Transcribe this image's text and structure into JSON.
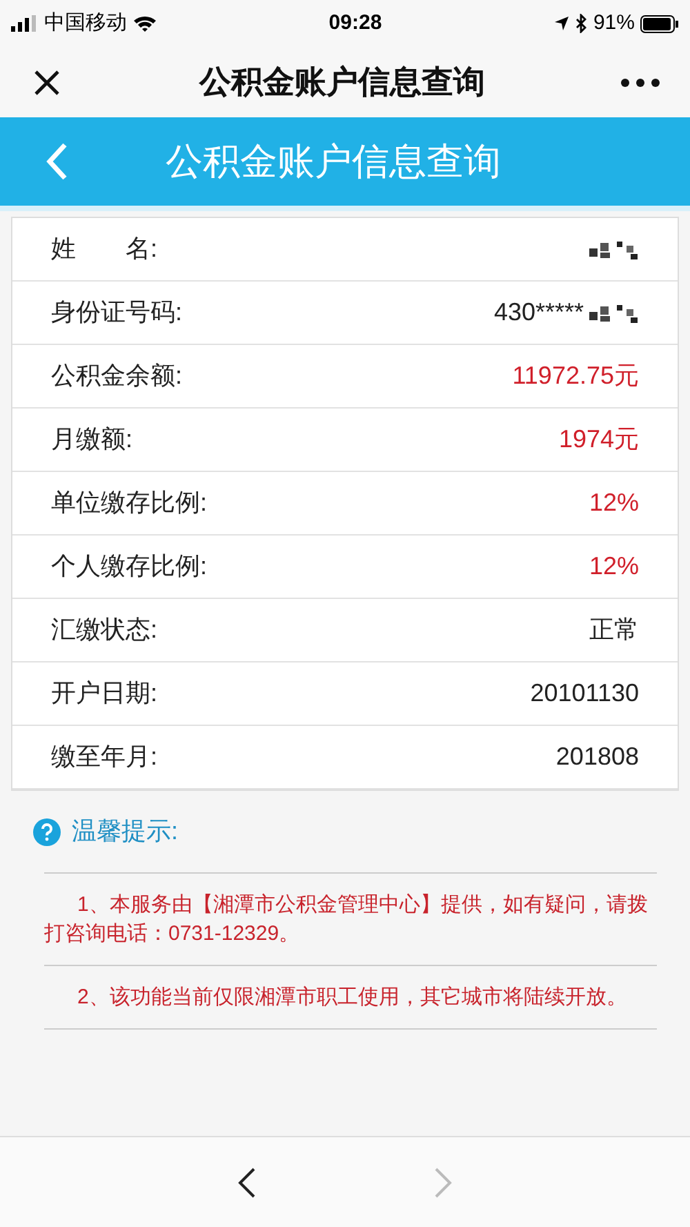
{
  "status_bar": {
    "carrier": "中国移动",
    "time": "09:28",
    "battery": "91%"
  },
  "nav_bar": {
    "title": "公积金账户信息查询"
  },
  "page_header": {
    "title": "公积金账户信息查询"
  },
  "fields": [
    {
      "label": "姓　　名:",
      "redacted": true
    },
    {
      "label": "身份证号码:",
      "value": "430*****",
      "redacted": true,
      "highlight": false
    },
    {
      "label": "公积金余额:",
      "value": "11972.75元",
      "redacted": false,
      "highlight": true
    },
    {
      "label": "月缴额:",
      "value": "1974元",
      "redacted": false,
      "highlight": true
    },
    {
      "label": "单位缴存比例:",
      "value": "12%",
      "redacted": false,
      "highlight": true
    },
    {
      "label": "个人缴存比例:",
      "value": "12%",
      "redacted": false,
      "highlight": true
    },
    {
      "label": "汇缴状态:",
      "value": "正常",
      "redacted": false,
      "highlight": false
    },
    {
      "label": "开户日期:",
      "value": "20101130",
      "redacted": false,
      "highlight": false
    },
    {
      "label": "缴至年月:",
      "value": "201808",
      "redacted": false,
      "highlight": false
    }
  ],
  "tips": {
    "title": "温馨提示:",
    "items": [
      "1、本服务由【湘潭市公积金管理中心】提供，如有疑问，请拨打咨询电话：0731-12329。",
      "2、该功能当前仅限湘潭市职工使用，其它城市将陆续开放。"
    ]
  },
  "toolbar": {
    "back_disabled": false,
    "forward_disabled": true
  }
}
